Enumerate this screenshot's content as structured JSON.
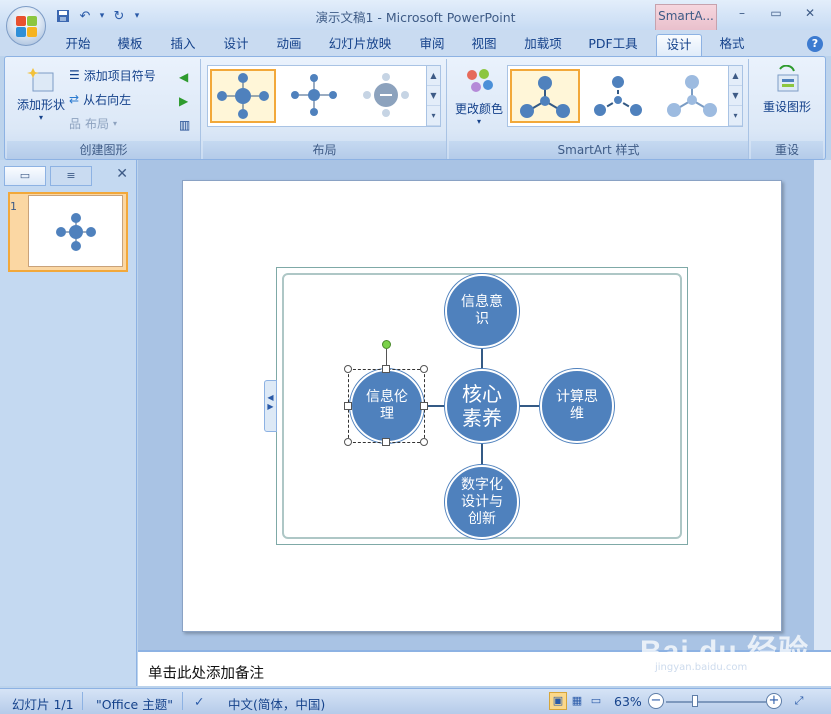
{
  "window": {
    "title": "演示文稿1 - Microsoft PowerPoint",
    "context_tab": "SmartA...",
    "controls": [
      "–",
      "▭",
      "✕"
    ]
  },
  "tabs": [
    "开始",
    "模板",
    "插入",
    "设计",
    "动画",
    "幻灯片放映",
    "审阅",
    "视图",
    "加载项",
    "PDF工具",
    "设计",
    "格式"
  ],
  "ribbon": {
    "create_graphic": {
      "label": "创建图形",
      "add_shape": "添加形状",
      "add_bullet": "添加项目符号",
      "right_to_left": "从右向左",
      "layout": "布局"
    },
    "layouts": {
      "label": "布局"
    },
    "styles": {
      "label": "SmartArt 样式",
      "change_colors": "更改颜色"
    },
    "reset": {
      "label": "重设",
      "reset_graphic": "重设图形"
    }
  },
  "slide_pane": {
    "slide_number": "1"
  },
  "smartart": {
    "center": "核心素养",
    "top": "信息意识",
    "left": "信息伦理",
    "right": "计算思维",
    "bottom": "数字化设计与创新"
  },
  "notes": {
    "placeholder": "单击此处添加备注"
  },
  "watermark": {
    "main": "Bai du 经验",
    "sub": "jingyan.baidu.com"
  },
  "statusbar": {
    "slide": "幻灯片 1/1",
    "theme": "\"Office 主题\"",
    "language": "中文(简体，中国)",
    "zoom": "63%"
  }
}
